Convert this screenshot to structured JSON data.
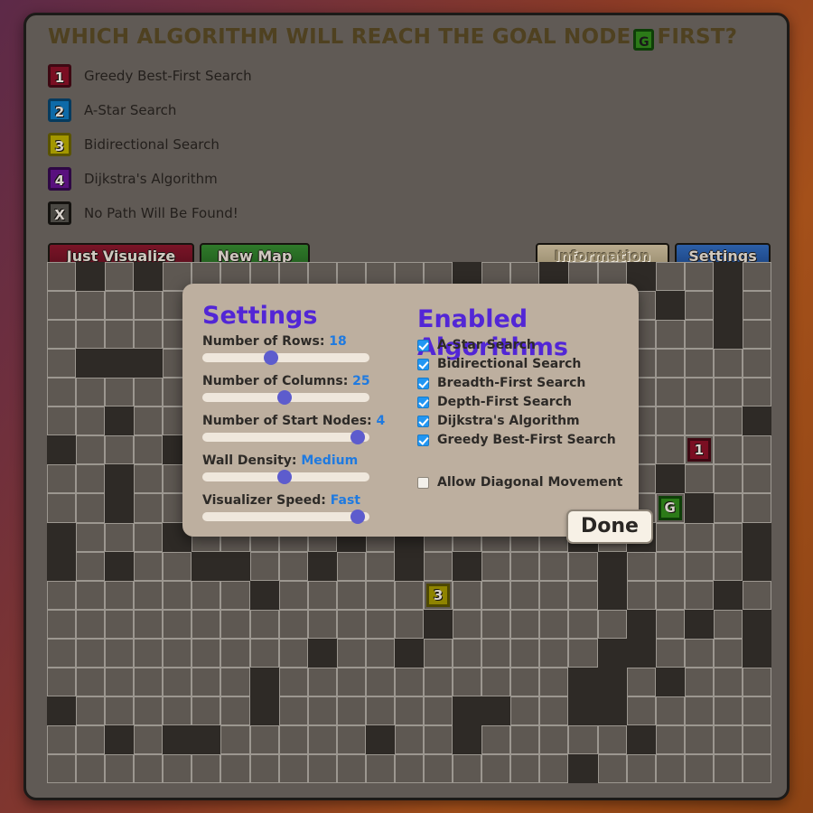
{
  "header": {
    "question_before": "WHICH ALGORITHM WILL REACH THE GOAL NODE",
    "goal_badge": "G",
    "question_after": "FIRST?",
    "goal_badge_color": "#2c7a18"
  },
  "legend": {
    "items": [
      {
        "badge": "1",
        "label": "Greedy Best-First Search",
        "fill": "#7a0e22",
        "border": "#3d0812"
      },
      {
        "badge": "2",
        "label": "A-Star Search",
        "fill": "#0e6aa8",
        "border": "#073b5e"
      },
      {
        "badge": "3",
        "label": "Bidirectional Search",
        "fill": "#a39700",
        "border": "#5a5300"
      },
      {
        "badge": "4",
        "label": "Dijkstra's Algorithm",
        "fill": "#59107e",
        "border": "#2e0844"
      },
      {
        "badge": "X",
        "label": "No Path Will Be Found!",
        "fill": "#4a4843",
        "border": "#14120f"
      }
    ]
  },
  "toolbar": {
    "visualize_label": "Just Visualize",
    "newmap_label": "New Map",
    "information_label": "Information",
    "settings_label": "Settings"
  },
  "modal": {
    "settings_heading": "Settings",
    "algorithms_heading": "Enabled Algorithms",
    "sliders": [
      {
        "label": "Number of Rows:",
        "value": "18",
        "pos": 41
      },
      {
        "label": "Number of Columns:",
        "value": "25",
        "pos": 49
      },
      {
        "label": "Number of Start Nodes:",
        "value": "4",
        "pos": 93
      },
      {
        "label": "Wall Density:",
        "value": "Medium",
        "pos": 49
      },
      {
        "label": "Visualizer Speed:",
        "value": "Fast",
        "pos": 93
      }
    ],
    "algorithms": [
      {
        "label": "A-Star Search",
        "checked": true
      },
      {
        "label": "Bidirectional Search",
        "checked": true
      },
      {
        "label": "Breadth-First Search",
        "checked": true
      },
      {
        "label": "Depth-First Search",
        "checked": true
      },
      {
        "label": "Dijkstra's Algorithm",
        "checked": true
      },
      {
        "label": "Greedy Best-First Search",
        "checked": true
      }
    ],
    "diagonal": {
      "label": "Allow Diagonal Movement",
      "checked": false
    },
    "done_label": "Done",
    "accent_color": "#5226d6",
    "value_color": "#1f7ae0"
  },
  "grid": {
    "rows": 18,
    "cols": 25,
    "cell_color": "#5e5852",
    "wall_color": "#2e2a26",
    "walls": [
      [
        0,
        1
      ],
      [
        0,
        3
      ],
      [
        0,
        14
      ],
      [
        0,
        17
      ],
      [
        0,
        20
      ],
      [
        0,
        23
      ],
      [
        1,
        8
      ],
      [
        1,
        21
      ],
      [
        1,
        23
      ],
      [
        2,
        23
      ],
      [
        3,
        1
      ],
      [
        3,
        2
      ],
      [
        3,
        3
      ],
      [
        3,
        10
      ],
      [
        3,
        13
      ],
      [
        4,
        5
      ],
      [
        4,
        16
      ],
      [
        5,
        2
      ],
      [
        5,
        5
      ],
      [
        5,
        12
      ],
      [
        5,
        24
      ],
      [
        6,
        0
      ],
      [
        6,
        4
      ],
      [
        6,
        10
      ],
      [
        6,
        18
      ],
      [
        7,
        2
      ],
      [
        7,
        8
      ],
      [
        7,
        21
      ],
      [
        8,
        2
      ],
      [
        8,
        9
      ],
      [
        8,
        22
      ],
      [
        9,
        0
      ],
      [
        9,
        4
      ],
      [
        9,
        10
      ],
      [
        9,
        12
      ],
      [
        9,
        18
      ],
      [
        9,
        20
      ],
      [
        9,
        24
      ],
      [
        10,
        0
      ],
      [
        10,
        2
      ],
      [
        10,
        5
      ],
      [
        10,
        6
      ],
      [
        10,
        9
      ],
      [
        10,
        12
      ],
      [
        10,
        14
      ],
      [
        10,
        24
      ],
      [
        10,
        19
      ],
      [
        11,
        7
      ],
      [
        11,
        13
      ],
      [
        11,
        19
      ],
      [
        11,
        23
      ],
      [
        12,
        13
      ],
      [
        12,
        20
      ],
      [
        12,
        22
      ],
      [
        12,
        24
      ],
      [
        13,
        9
      ],
      [
        13,
        12
      ],
      [
        13,
        19
      ],
      [
        13,
        20
      ],
      [
        13,
        24
      ],
      [
        14,
        7
      ],
      [
        14,
        18
      ],
      [
        14,
        19
      ],
      [
        14,
        21
      ],
      [
        15,
        0
      ],
      [
        15,
        7
      ],
      [
        15,
        14
      ],
      [
        15,
        15
      ],
      [
        15,
        18
      ],
      [
        15,
        19
      ],
      [
        16,
        2
      ],
      [
        16,
        4
      ],
      [
        16,
        5
      ],
      [
        16,
        11
      ],
      [
        16,
        14
      ],
      [
        16,
        20
      ],
      [
        17,
        18
      ]
    ],
    "nodes": [
      {
        "row": 6,
        "col": 22,
        "badge": "1",
        "fill": "#7a0e22",
        "border": "#3d0812"
      },
      {
        "row": 8,
        "col": 21,
        "badge": "G",
        "fill": "#2c7a18",
        "border": "#0e3e08"
      },
      {
        "row": 11,
        "col": 13,
        "badge": "3",
        "fill": "#8f8400",
        "border": "#4e4800"
      }
    ]
  }
}
